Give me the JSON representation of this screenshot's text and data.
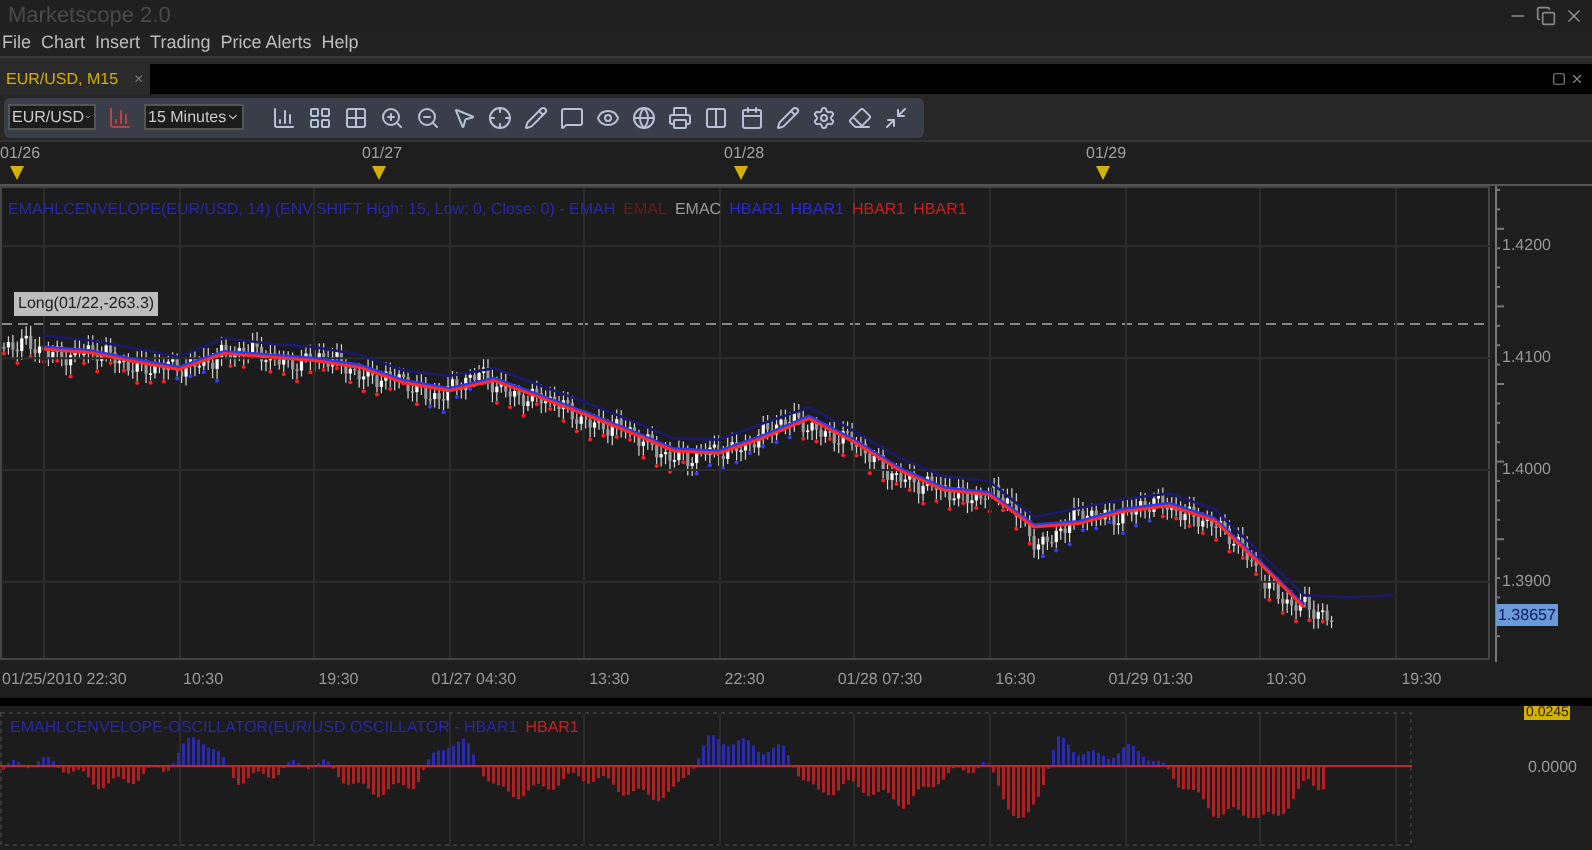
{
  "window": {
    "title": "Marketscope 2.0"
  },
  "menu": [
    "File",
    "Chart",
    "Insert",
    "Trading",
    "Price Alerts",
    "Help"
  ],
  "tabs": [
    {
      "label": "EUR/USD, M15",
      "selected": true,
      "close": "×"
    }
  ],
  "toolbar": {
    "symbol": "EUR/USD",
    "timeframe": "15 Minutes"
  },
  "date_markers": [
    "01/26",
    "01/27",
    "01/28",
    "01/29"
  ],
  "main_chart": {
    "legend": [
      {
        "text": "EMAHLCENVELOPE(EUR/USD, 14) (ENV.SHIFT High: 15, Low: 0, Close: 0) - EMAH",
        "color": "#2a2aa8"
      },
      {
        "text": "EMAL",
        "color": "#6a1c1c"
      },
      {
        "text": "EMAC",
        "color": "#9a9a9a"
      },
      {
        "text": "HBAR1",
        "color": "#2a2ad8"
      },
      {
        "text": "HBAR1",
        "color": "#2a2ad8"
      },
      {
        "text": "HBAR1",
        "color": "#c42222"
      },
      {
        "text": "HBAR1",
        "color": "#c42222"
      }
    ],
    "position_label": "Long(01/22,-263.3)",
    "current_price": "1.38657",
    "chart_data": {
      "type": "line",
      "ylim": [
        1.383,
        1.4254
      ],
      "grid": true,
      "yticks": [
        {
          "value": 1.42,
          "label": "1.4200"
        },
        {
          "value": 1.41,
          "label": "1.4100"
        },
        {
          "value": 1.4,
          "label": "1.4000"
        },
        {
          "value": 1.39,
          "label": "1.3900"
        }
      ],
      "series": [
        {
          "color": "#1a1a70",
          "values": [
            1.412,
            1.4116,
            1.4109,
            1.4101,
            1.4118,
            1.4113,
            1.411,
            1.4103,
            1.4089,
            1.4084,
            1.4091,
            1.4076,
            1.4061,
            1.4045,
            1.4028,
            1.4027,
            1.4042,
            1.4056,
            1.4035,
            1.4011,
            1.3994,
            1.399,
            1.3958,
            1.3966,
            1.3974,
            1.3979,
            1.3965,
            1.3927,
            1.3888,
            1.3886,
            1.3888
          ]
        },
        {
          "color": "#2a3af0",
          "values": [
            1.411,
            1.4107,
            1.4099,
            1.4092,
            1.4106,
            1.4103,
            1.41,
            1.4094,
            1.408,
            1.4073,
            1.4082,
            1.4067,
            1.4052,
            1.4036,
            1.4019,
            1.4017,
            1.4031,
            1.4048,
            1.4027,
            1.4002,
            1.3984,
            1.398,
            1.3951,
            1.3954,
            1.3965,
            1.397,
            1.3957,
            1.3919,
            1.3879,
            null,
            null
          ]
        },
        {
          "color": "#ff2a2a",
          "values": [
            1.4108,
            1.4105,
            1.4097,
            1.409,
            1.4104,
            1.4101,
            1.4098,
            1.4092,
            1.4078,
            1.4071,
            1.408,
            1.4065,
            1.405,
            1.4034,
            1.4017,
            1.4015,
            1.4029,
            1.4046,
            1.4025,
            1.4,
            1.3982,
            1.3978,
            1.3949,
            1.3952,
            1.3963,
            1.3968,
            1.3955,
            1.3917,
            1.3877,
            null,
            null
          ]
        }
      ]
    }
  },
  "time_axis": [
    "01/25/2010 22:30",
    "10:30",
    "19:30",
    "01/27 04:30",
    "13:30",
    "22:30",
    "01/28 07:30",
    "16:30",
    "01/29 01:30",
    "10:30",
    "19:30"
  ],
  "oscillator": {
    "legend": [
      {
        "text": "EMAHLCENVELOPE-OSCILLATOR(EUR/USD OSCILLATOR - HBAR1",
        "color": "#2a2aa8"
      },
      {
        "text": "HBAR1",
        "color": "#c42222"
      }
    ],
    "value_label": "0.0245",
    "zero_label": "0.0000"
  }
}
